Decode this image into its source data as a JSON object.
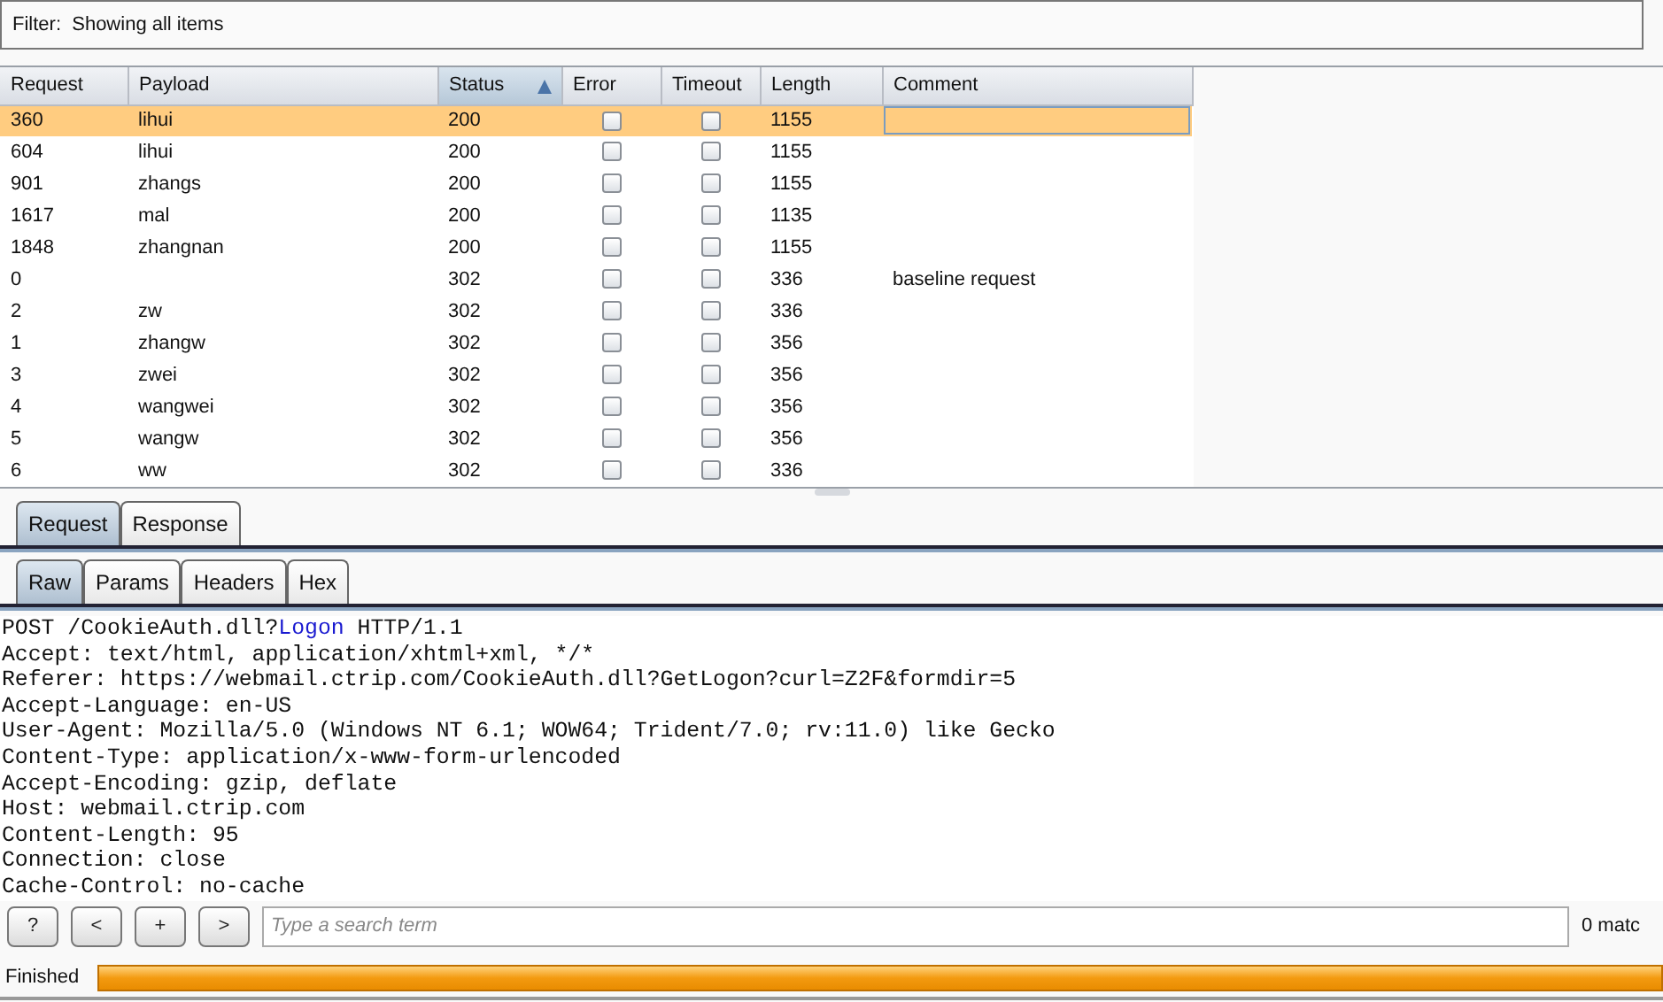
{
  "filter": {
    "label": "Filter:",
    "value": "Showing all items"
  },
  "table": {
    "columns": [
      {
        "label": "Request",
        "sorted": false
      },
      {
        "label": "Payload",
        "sorted": false
      },
      {
        "label": "Status",
        "sorted": true
      },
      {
        "label": "Error",
        "sorted": false
      },
      {
        "label": "Timeout",
        "sorted": false
      },
      {
        "label": "Length",
        "sorted": false
      },
      {
        "label": "Comment",
        "sorted": false
      }
    ],
    "rows": [
      {
        "request": "360",
        "payload": "lihui",
        "status": "200",
        "error": false,
        "timeout": false,
        "length": "1155",
        "comment": "",
        "selected": true
      },
      {
        "request": "604",
        "payload": "lihui",
        "status": "200",
        "error": false,
        "timeout": false,
        "length": "1155",
        "comment": "",
        "selected": false
      },
      {
        "request": "901",
        "payload": "zhangs",
        "status": "200",
        "error": false,
        "timeout": false,
        "length": "1155",
        "comment": "",
        "selected": false
      },
      {
        "request": "1617",
        "payload": "mal",
        "status": "200",
        "error": false,
        "timeout": false,
        "length": "1135",
        "comment": "",
        "selected": false
      },
      {
        "request": "1848",
        "payload": "zhangnan",
        "status": "200",
        "error": false,
        "timeout": false,
        "length": "1155",
        "comment": "",
        "selected": false
      },
      {
        "request": "0",
        "payload": "",
        "status": "302",
        "error": false,
        "timeout": false,
        "length": "336",
        "comment": "baseline request",
        "selected": false
      },
      {
        "request": "2",
        "payload": "zw",
        "status": "302",
        "error": false,
        "timeout": false,
        "length": "336",
        "comment": "",
        "selected": false
      },
      {
        "request": "1",
        "payload": "zhangw",
        "status": "302",
        "error": false,
        "timeout": false,
        "length": "356",
        "comment": "",
        "selected": false
      },
      {
        "request": "3",
        "payload": "zwei",
        "status": "302",
        "error": false,
        "timeout": false,
        "length": "356",
        "comment": "",
        "selected": false
      },
      {
        "request": "4",
        "payload": "wangwei",
        "status": "302",
        "error": false,
        "timeout": false,
        "length": "356",
        "comment": "",
        "selected": false
      },
      {
        "request": "5",
        "payload": "wangw",
        "status": "302",
        "error": false,
        "timeout": false,
        "length": "356",
        "comment": "",
        "selected": false
      },
      {
        "request": "6",
        "payload": "ww",
        "status": "302",
        "error": false,
        "timeout": false,
        "length": "336",
        "comment": "",
        "selected": false
      }
    ]
  },
  "tabs": [
    {
      "label": "Request",
      "selected": true
    },
    {
      "label": "Response",
      "selected": false
    }
  ],
  "subtabs": [
    {
      "label": "Raw",
      "selected": true
    },
    {
      "label": "Params",
      "selected": false
    },
    {
      "label": "Headers",
      "selected": false
    },
    {
      "label": "Hex",
      "selected": false
    }
  ],
  "request_lines": [
    [
      {
        "kind": "plain",
        "text": "POST /CookieAuth.dll?"
      },
      {
        "kind": "param",
        "text": "Logon"
      },
      {
        "kind": "plain",
        "text": " HTTP/1.1"
      }
    ],
    [
      {
        "kind": "plain",
        "text": "Accept: text/html, application/xhtml+xml, */*"
      }
    ],
    [
      {
        "kind": "plain",
        "text": "Referer: https://webmail.ctrip.com/CookieAuth.dll?GetLogon?curl=Z2F&formdir=5"
      }
    ],
    [
      {
        "kind": "plain",
        "text": "Accept-Language: en-US"
      }
    ],
    [
      {
        "kind": "plain",
        "text": "User-Agent: Mozilla/5.0 (Windows NT 6.1; WOW64; Trident/7.0; rv:11.0) like Gecko"
      }
    ],
    [
      {
        "kind": "plain",
        "text": "Content-Type: application/x-www-form-urlencoded"
      }
    ],
    [
      {
        "kind": "plain",
        "text": "Accept-Encoding: gzip, deflate"
      }
    ],
    [
      {
        "kind": "plain",
        "text": "Host: webmail.ctrip.com"
      }
    ],
    [
      {
        "kind": "plain",
        "text": "Content-Length: 95"
      }
    ],
    [
      {
        "kind": "plain",
        "text": "Connection: close"
      }
    ],
    [
      {
        "kind": "plain",
        "text": "Cache-Control: no-cache"
      }
    ]
  ],
  "search": {
    "buttons": [
      "?",
      "<",
      "+",
      ">"
    ],
    "placeholder": "Type a search term",
    "matches": "0 matc"
  },
  "status_bar": {
    "text": "Finished",
    "level": 1
  }
}
